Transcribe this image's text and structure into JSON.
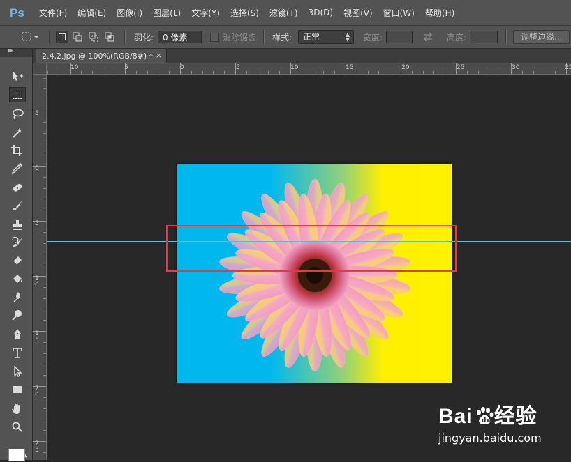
{
  "app": {
    "logo": "Ps"
  },
  "menu": {
    "items": [
      "文件(F)",
      "编辑(E)",
      "图像(I)",
      "图层(L)",
      "文字(Y)",
      "选择(S)",
      "滤镜(T)",
      "3D(D)",
      "视图(V)",
      "窗口(W)",
      "帮助(H)"
    ]
  },
  "options": {
    "feather_label": "羽化:",
    "feather_value": "0 像素",
    "antialias_label": "消除锯齿",
    "style_label": "样式:",
    "style_value": "正常",
    "width_label": "宽度:",
    "width_value": "",
    "height_label": "高度:",
    "height_value": "",
    "refine_edge_label": "调整边缘..."
  },
  "tools": [
    {
      "name": "move-tool-icon",
      "active": false
    },
    {
      "name": "rectangular-marquee-tool-icon",
      "active": true
    },
    {
      "name": "lasso-tool-icon",
      "active": false
    },
    {
      "name": "magic-wand-tool-icon",
      "active": false
    },
    {
      "name": "crop-tool-icon",
      "active": false
    },
    {
      "name": "eyedropper-tool-icon",
      "active": false
    },
    {
      "name": "spot-healing-brush-tool-icon",
      "active": false
    },
    {
      "name": "brush-tool-icon",
      "active": false
    },
    {
      "name": "clone-stamp-tool-icon",
      "active": false
    },
    {
      "name": "history-brush-tool-icon",
      "active": false
    },
    {
      "name": "eraser-tool-icon",
      "active": false
    },
    {
      "name": "paint-bucket-tool-icon",
      "active": false
    },
    {
      "name": "blur-tool-icon",
      "active": false
    },
    {
      "name": "dodge-tool-icon",
      "active": false
    },
    {
      "name": "pen-tool-icon",
      "active": false
    },
    {
      "name": "type-tool-icon",
      "active": false
    },
    {
      "name": "path-selection-tool-icon",
      "active": false
    },
    {
      "name": "rectangle-tool-icon",
      "active": false
    },
    {
      "name": "hand-tool-icon",
      "active": false
    },
    {
      "name": "zoom-tool-icon",
      "active": false
    }
  ],
  "document": {
    "tab_title": "2.4.2.jpg @ 100%(RGB/8#) *",
    "close_glyph": "×"
  },
  "rulers": {
    "top_labels": [
      "10",
      "5",
      "0",
      "5",
      "10",
      "15",
      "20",
      "25",
      "30",
      "35"
    ],
    "left_labels": [
      "5",
      "0",
      "5",
      "1\n0",
      "1\n5",
      "2\n0",
      "2\n5"
    ]
  },
  "watermark": {
    "logo_left": "Bai",
    "logo_right": "经验",
    "url": "jingyan.baidu.com"
  },
  "colors": {
    "chrome": "#535353",
    "canvas": "#282828",
    "guide": "#49c8da",
    "annotation": "#e53a40",
    "image_blue": "#00b8ee",
    "image_yellow": "#fff200"
  }
}
